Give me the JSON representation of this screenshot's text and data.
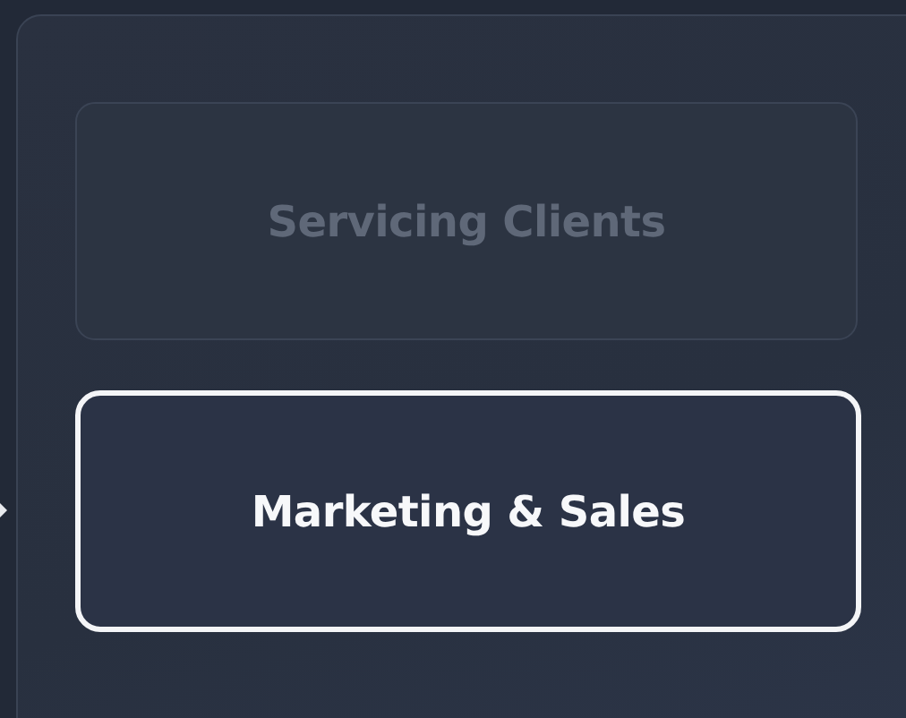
{
  "options": [
    {
      "label": "Servicing Clients",
      "selected": false
    },
    {
      "label": "Marketing & Sales",
      "selected": true
    }
  ]
}
